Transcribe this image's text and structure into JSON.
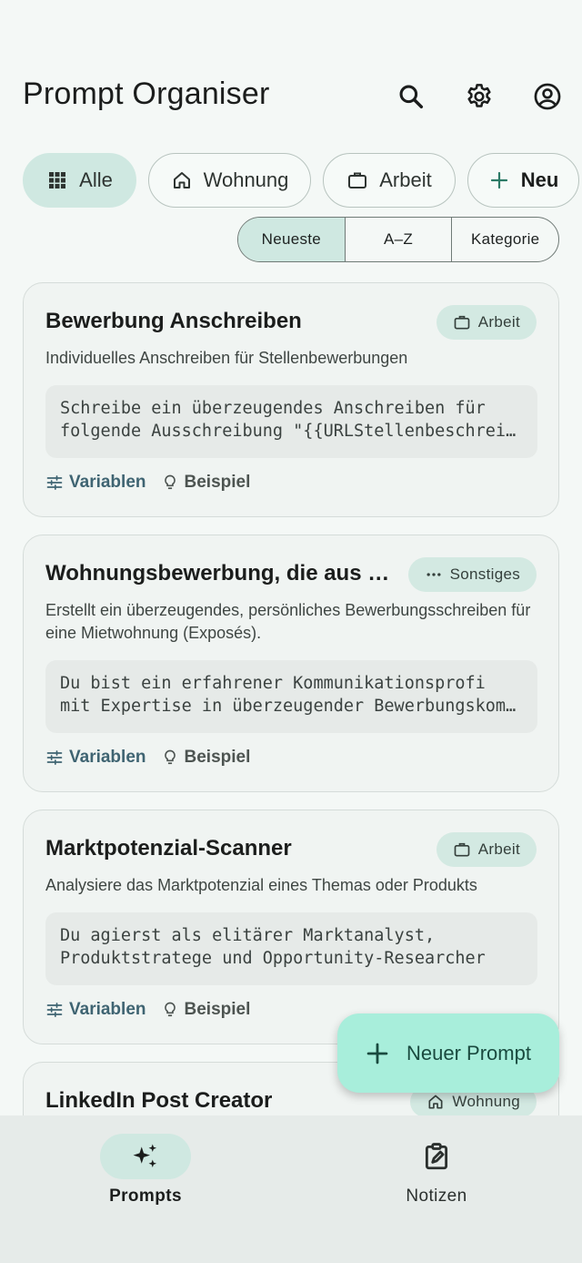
{
  "app": {
    "title": "Prompt Organiser"
  },
  "appbar_icons": [
    "search-icon",
    "settings-icon",
    "account-icon"
  ],
  "chips": [
    {
      "label": "Alle",
      "icon": "grid-icon",
      "active": true
    },
    {
      "label": "Wohnung",
      "icon": "home-icon",
      "active": false
    },
    {
      "label": "Arbeit",
      "icon": "briefcase-icon",
      "active": false
    },
    {
      "label": "Neu",
      "icon": "plus-icon",
      "active": false
    }
  ],
  "sort": {
    "options": [
      "Neueste",
      "A–Z",
      "Kategorie"
    ],
    "selected": "Neueste"
  },
  "cards": [
    {
      "title": "Bewerbung Anschreiben",
      "category": "Arbeit",
      "category_icon": "briefcase-icon",
      "description": "Individuelles Anschreiben für Stellenbewerbungen",
      "code_line1": "Schreibe ein überzeugendes Anschreiben für",
      "code_line2": "folgende Ausschreibung \"{{URLStellenbeschreibung}}\"",
      "variables_label": "Variablen",
      "example_label": "Beispiel"
    },
    {
      "title": "Wohnungsbewerbung, die aus der Masse heraussticht",
      "category": "Sonstiges",
      "category_icon": "more-icon",
      "description": "Erstellt ein überzeugendes, persönliches Bewerbungsschreiben für eine Mietwohnung (Exposés).",
      "code_line1": "Du bist ein erfahrener Kommunikationsprofi",
      "code_line2": "mit Expertise in überzeugender Bewerbungskommunikation",
      "variables_label": "Variablen",
      "example_label": "Beispiel"
    },
    {
      "title": "Marktpotenzial-Scanner",
      "category": "Arbeit",
      "category_icon": "briefcase-icon",
      "description": "Analysiere das Marktpotenzial eines Themas oder Produkts",
      "code_line1": "Du agierst als elitärer Marktanalyst,",
      "code_line2": "Produktstratege und Opportunity-Researcher",
      "variables_label": "Variablen",
      "example_label": "Beispiel"
    },
    {
      "title": "LinkedIn Post Creator",
      "category": "Wohnung",
      "category_icon": "home-icon"
    }
  ],
  "fab": {
    "label": "Neuer Prompt"
  },
  "bottom_nav": [
    {
      "label": "Prompts",
      "icon": "sparkles-icon",
      "active": true
    },
    {
      "label": "Notizen",
      "icon": "clipboard-edit-icon",
      "active": false
    }
  ],
  "colors": {
    "background": "#f4f8f6",
    "accent_container": "#cfe8e1",
    "fab": "#a8eedb",
    "variables_text": "#3f6472"
  }
}
